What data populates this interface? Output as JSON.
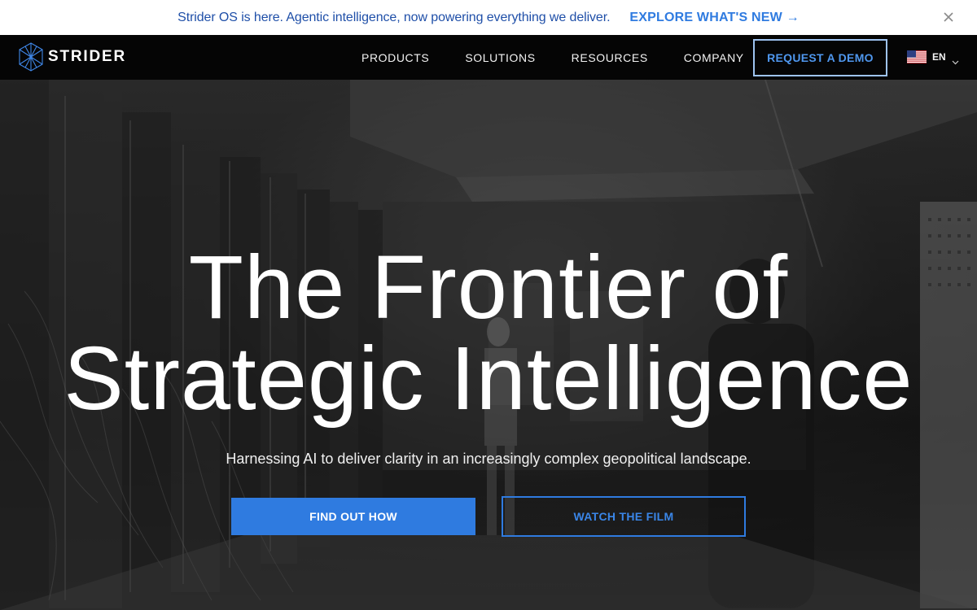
{
  "announcement": {
    "text": "Strider OS is here. Agentic intelligence, now powering everything we deliver.",
    "link_label": "EXPLORE WHAT'S NEW →",
    "close_icon": "close-icon"
  },
  "nav": {
    "brand": "STRIDER",
    "logo_icon": "strider-logo-icon",
    "links": [
      "PRODUCTS",
      "SOLUTIONS",
      "RESOURCES",
      "COMPANY"
    ],
    "demo_label": "REQUEST A DEMO",
    "language": "EN",
    "flag_icon": "us-flag-icon"
  },
  "hero": {
    "headline_line1": "The Frontier of",
    "headline_line2": "Strategic Intelligence",
    "subheadline": "Harnessing AI to deliver clarity in an increasingly complex geopolitical landscape.",
    "primary_cta": "FIND OUT HOW",
    "secondary_cta": "WATCH THE FILM"
  },
  "colors": {
    "accent": "#2f7be0",
    "announcement_text": "#1f4fa8",
    "nav_background": "#050505",
    "demo_border": "#9ec3f0"
  }
}
